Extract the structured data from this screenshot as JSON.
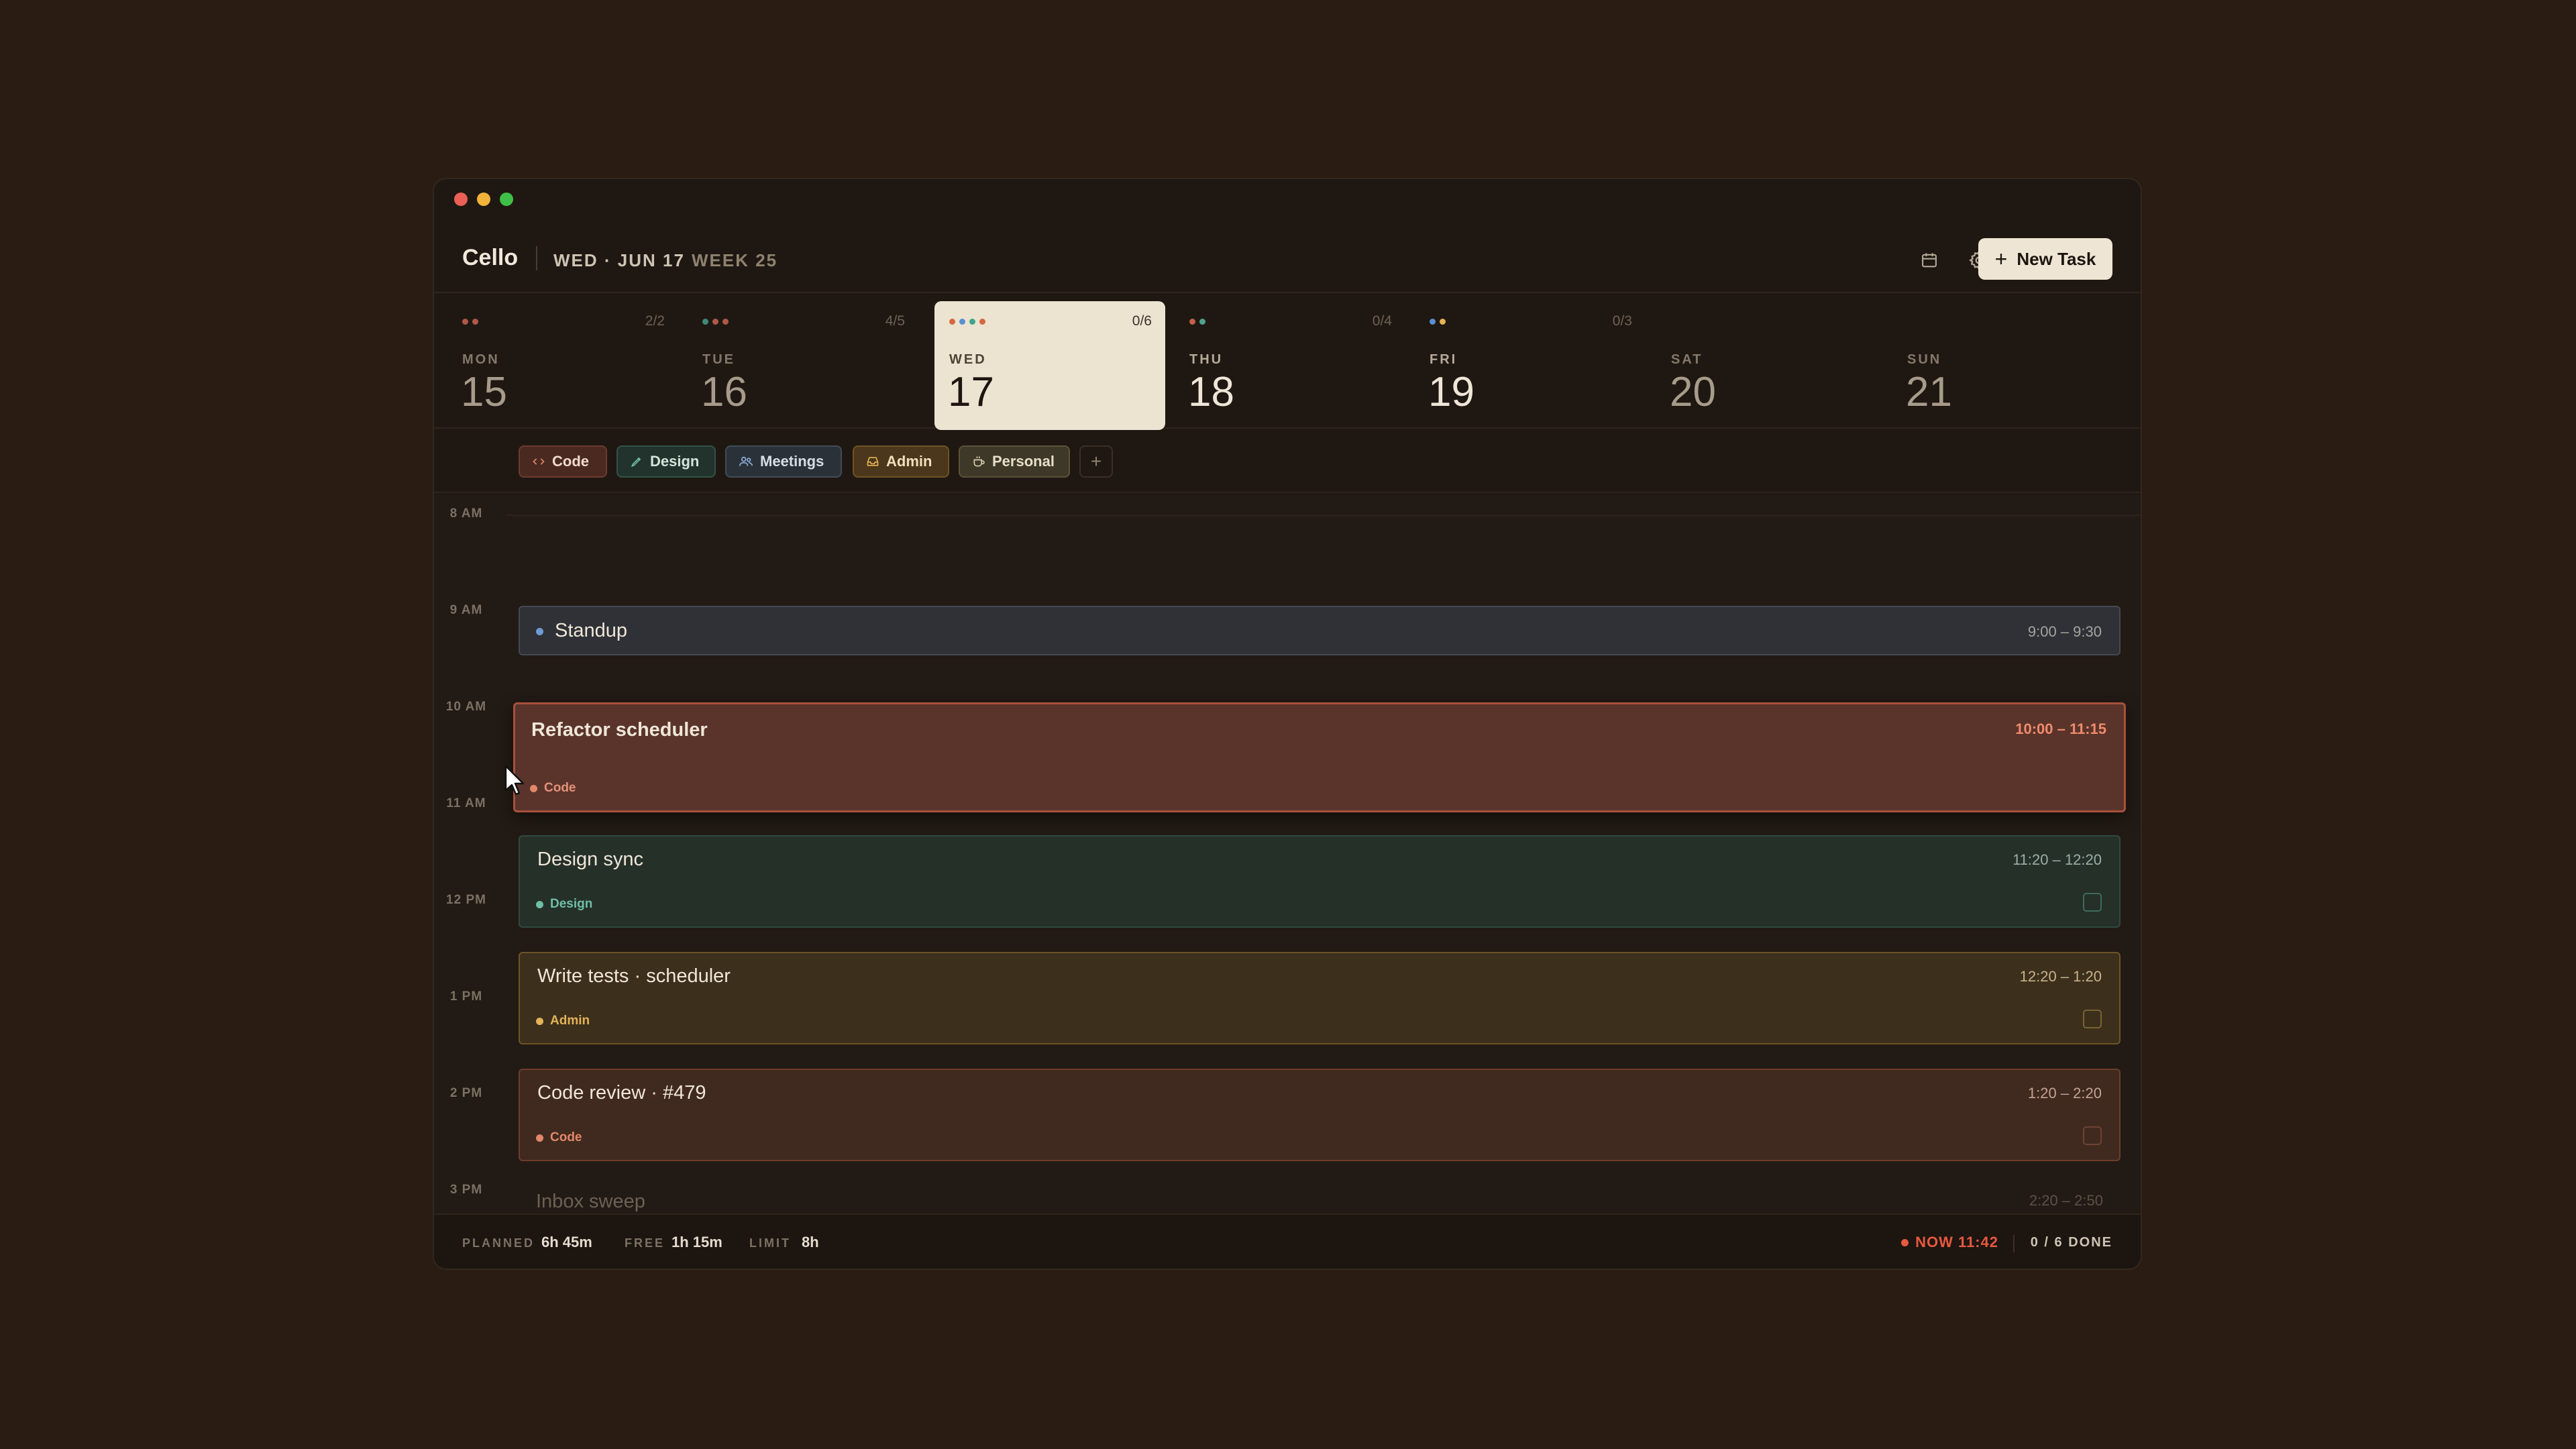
{
  "app": {
    "name": "Cello"
  },
  "header": {
    "date": "WED · JUN 17",
    "week": "WEEK 25",
    "new_task_label": "New Task",
    "new_task_plus": "+"
  },
  "days": [
    {
      "name": "MON",
      "num": "15",
      "count": "2/2",
      "dots": [
        "#c0614a",
        "#c0614a"
      ]
    },
    {
      "name": "TUE",
      "num": "16",
      "count": "4/5",
      "dots": [
        "#4fa38c",
        "#c0614a",
        "#c0614a"
      ]
    },
    {
      "name": "WED",
      "num": "17",
      "count": "0/6",
      "dots": [
        "#d4683f",
        "#5b8fd0",
        "#3fa58a",
        "#d4683f"
      ]
    },
    {
      "name": "THU",
      "num": "18",
      "count": "0/4",
      "dots": [
        "#c0614a",
        "#4fa38c"
      ]
    },
    {
      "name": "FRI",
      "num": "19",
      "count": "0/3",
      "dots": [
        "#5b8fd0",
        "#e4b257"
      ]
    },
    {
      "name": "SAT",
      "num": "20",
      "count": "",
      "dots": []
    },
    {
      "name": "SUN",
      "num": "21",
      "count": "",
      "dots": []
    }
  ],
  "categories": {
    "code": "Code",
    "design": "Design",
    "meetings": "Meetings",
    "admin": "Admin",
    "personal": "Personal",
    "add": "+"
  },
  "hours": [
    "8 AM",
    "9 AM",
    "10 AM",
    "11 AM",
    "12 PM",
    "1 PM",
    "2 PM",
    "3 PM"
  ],
  "events": {
    "standup": {
      "title": "Standup",
      "time": "9:00 – 9:30"
    },
    "refactor": {
      "title": "Refactor scheduler",
      "time": "10:00 – 11:15",
      "tag": "Code"
    },
    "design_sync": {
      "title": "Design sync",
      "time": "11:20 – 12:20",
      "tag": "Design"
    },
    "tests": {
      "title": "Write tests · scheduler",
      "time": "12:20 – 1:20",
      "tag": "Admin"
    },
    "review": {
      "title": "Code review · #479",
      "time": "1:20 – 2:20",
      "tag": "Code"
    },
    "inbox": {
      "title": "Inbox sweep",
      "time": "2:20 – 2:50"
    }
  },
  "footer": {
    "planned_label": "PLANNED",
    "planned_value": "6h 45m",
    "free_label": "FREE",
    "free_value": "1h 15m",
    "limit_label": "LIMIT",
    "limit_value": "8h",
    "now": "NOW 11:42",
    "done": "0 / 6 DONE"
  },
  "colors": {
    "code": "#e2876c",
    "design": "#6fbfa6",
    "meetings": "#6f9ad6",
    "admin": "#e4b257",
    "now": "#e8593f"
  }
}
